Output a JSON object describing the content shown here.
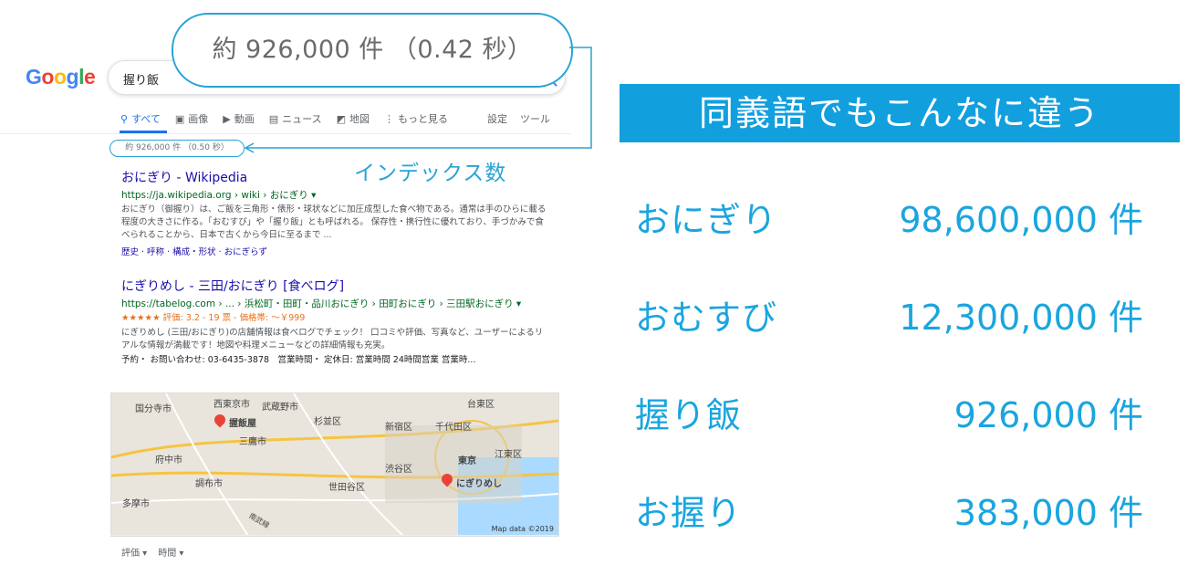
{
  "search": {
    "query": "握り飯",
    "tabs": [
      {
        "icon": "search-icon",
        "label": "すべて",
        "active": true
      },
      {
        "icon": "image-icon",
        "label": "画像"
      },
      {
        "icon": "video-icon",
        "label": "動画"
      },
      {
        "icon": "news-icon",
        "label": "ニュース"
      },
      {
        "icon": "map-icon",
        "label": "地図"
      },
      {
        "icon": "more-icon",
        "label": "もっと見る"
      }
    ],
    "settings_label": "設定",
    "tools_label": "ツール",
    "stats": "約 926,000 件 （0.50 秒）"
  },
  "callout": {
    "bubble_text": "約 926,000 件 （0.42 秒）",
    "index_label": "インデックス数"
  },
  "results": [
    {
      "title": "おにぎり - Wikipedia",
      "url": "https://ja.wikipedia.org › wiki › おにぎり ▾",
      "snippet": "おにぎり（御握り）は、ご飯を三角形・俵形・球状などに加圧成型した食べ物である。通常は手のひらに載る程度の大きさに作る。「おむすび」や「握り飯」とも呼ばれる。 保存性・携行性に優れており、手づかみで食べられることから、日本で古くから今日に至るまで ...",
      "links": "歴史 · 呼称 · 構成・形状 · おにぎらず"
    },
    {
      "title": "にぎりめし - 三田/おにぎり [食べログ]",
      "url": "https://tabelog.com › ... › 浜松町・田町・品川おにぎり › 田町おにぎり › 三田駅おにぎり ▾",
      "rating": "★★★★★ 評価: 3.2 - 19 票 - 価格帯: ～￥999",
      "snippet": "にぎりめし (三田/おにぎり)の店舗情報は食べログでチェック！ 口コミや評価、写真など、ユーザーによるリアルな情報が満載です！地図や料理メニューなどの詳細情報も充実。",
      "links": "予約・ お問い合わせ: 03-6435-3878　営業時間・ 定休日: 営業時間 24時間営業 営業時..."
    }
  ],
  "map": {
    "labels": [
      "国分寺市",
      "西東京市",
      "武蔵野市",
      "台東区",
      "握飯屋",
      "杉並区",
      "新宿区",
      "千代田区",
      "三鷹市",
      "府中市",
      "東京",
      "江東区",
      "渋谷区",
      "調布市",
      "世田谷区",
      "にぎりめし",
      "多摩市",
      "南武線"
    ],
    "credit": "Map data ©2019"
  },
  "filters": [
    "評価 ▾",
    "時間 ▾"
  ],
  "panel": {
    "banner": "同義語でもこんなに違う",
    "rows": [
      {
        "term": "おにぎり",
        "count": "98,600,000 件"
      },
      {
        "term": "おむすび",
        "count": "12,300,000 件"
      },
      {
        "term": "握り飯",
        "count": "926,000 件"
      },
      {
        "term": "お握り",
        "count": "383,000 件"
      }
    ]
  },
  "colors": {
    "accent": "#29a3d4",
    "banner": "#129fde",
    "link": "#1a0dab",
    "url": "#006621"
  }
}
